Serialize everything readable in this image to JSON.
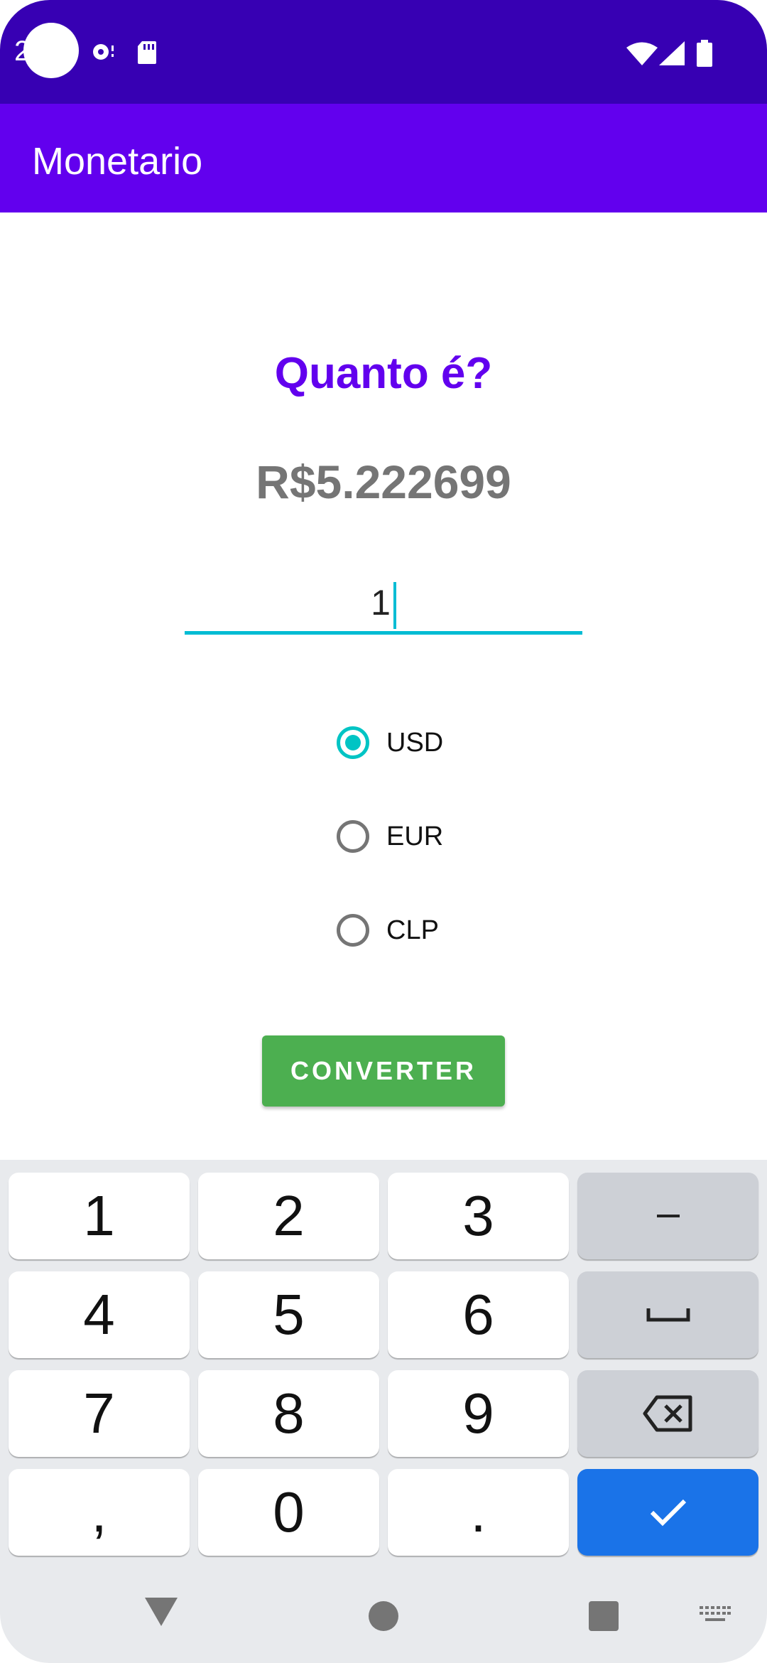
{
  "status_bar": {
    "time": "2"
  },
  "app_bar": {
    "title": "Monetario"
  },
  "heading": "Quanto é?",
  "result": "R$5.222699",
  "amount_input": {
    "value": "1"
  },
  "currencies": [
    {
      "label": "USD",
      "checked": true
    },
    {
      "label": "EUR",
      "checked": false
    },
    {
      "label": "CLP",
      "checked": false
    }
  ],
  "convert_button": {
    "label": "CONVERTER"
  },
  "keyboard": {
    "row1": [
      "1",
      "2",
      "3"
    ],
    "row2": [
      "4",
      "5",
      "6"
    ],
    "row3": [
      "7",
      "8",
      "9"
    ],
    "row4": [
      ",",
      "0",
      "."
    ],
    "function_keys": [
      "minus-icon",
      "space-icon",
      "backspace-icon",
      "check-icon"
    ]
  },
  "colors": {
    "status_bar": "#3700b3",
    "app_bar": "#6200ee",
    "accent": "#00bcd4",
    "button": "#4caf50",
    "done_key": "#1a73e8"
  }
}
